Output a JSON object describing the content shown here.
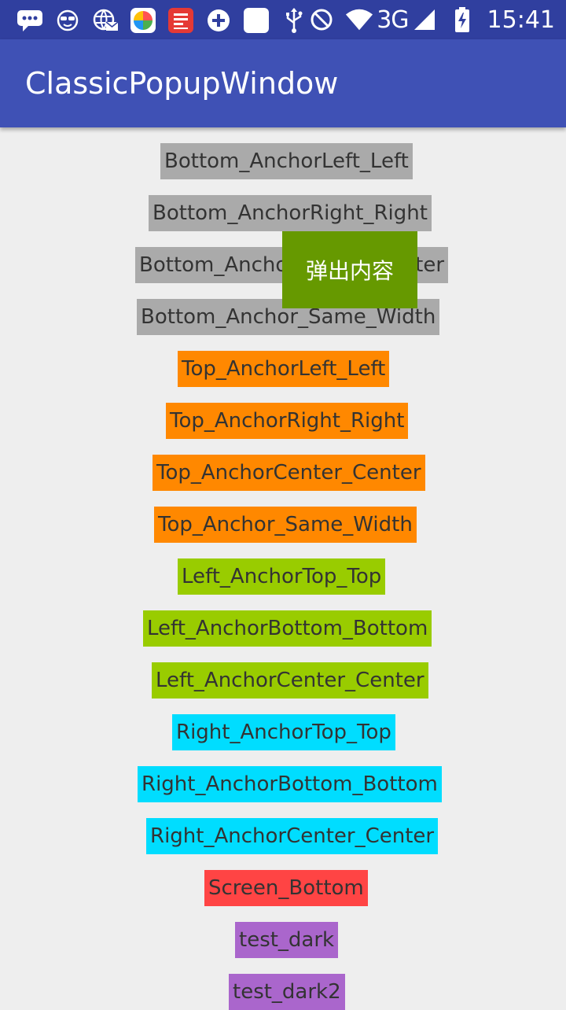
{
  "status_bar": {
    "left_icons": [
      "chat-bubble-icon",
      "sunglasses-face-icon",
      "globe-mail-icon",
      "colorful-app-icon",
      "red-news-app-icon",
      "plus-circle-icon",
      "blank-square-icon",
      "usb-icon"
    ],
    "network": "3G",
    "time": "15:41"
  },
  "app_bar": {
    "title": "ClassicPopupWindow"
  },
  "buttons": [
    {
      "label": "Bottom_AnchorLeft_Left",
      "color": "#aaaaaa"
    },
    {
      "label": "Bottom_AnchorRight_Right",
      "color": "#aaaaaa"
    },
    {
      "label": "Bottom_AnchorCenter_Center",
      "color": "#aaaaaa"
    },
    {
      "label": "Bottom_Anchor_Same_Width",
      "color": "#aaaaaa"
    },
    {
      "label": "Top_AnchorLeft_Left",
      "color": "#ff8800"
    },
    {
      "label": "Top_AnchorRight_Right",
      "color": "#ff8800"
    },
    {
      "label": "Top_AnchorCenter_Center",
      "color": "#ff8800"
    },
    {
      "label": "Top_Anchor_Same_Width",
      "color": "#ff8800"
    },
    {
      "label": "Left_AnchorTop_Top",
      "color": "#99cc00"
    },
    {
      "label": "Left_AnchorBottom_Bottom",
      "color": "#99cc00"
    },
    {
      "label": "Left_AnchorCenter_Center",
      "color": "#99cc00"
    },
    {
      "label": "Right_AnchorTop_Top",
      "color": "#00ddff"
    },
    {
      "label": "Right_AnchorBottom_Bottom",
      "color": "#00ddff"
    },
    {
      "label": "Right_AnchorCenter_Center",
      "color": "#00ddff"
    },
    {
      "label": "Screen_Bottom",
      "color": "#ff4444"
    },
    {
      "label": "test_dark",
      "color": "#aa66cc"
    },
    {
      "label": "test_dark2",
      "color": "#aa66cc"
    }
  ],
  "popup": {
    "text": "弹出内容",
    "color": "#669900"
  }
}
